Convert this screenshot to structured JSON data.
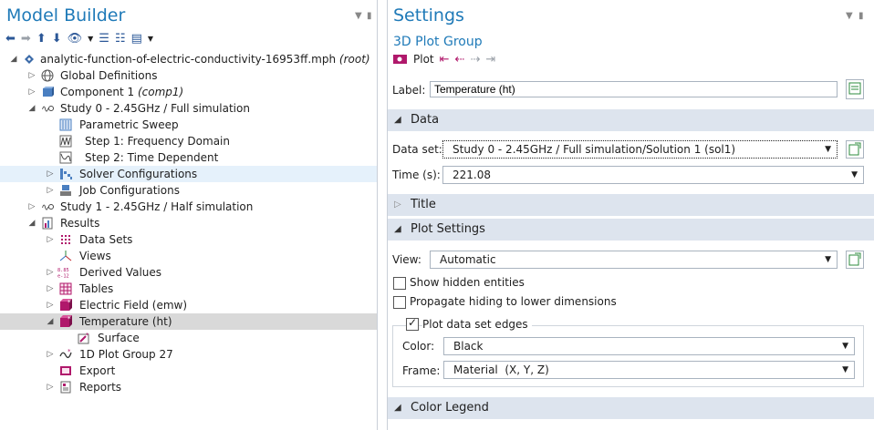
{
  "model_builder": {
    "title": "Model Builder",
    "tree": [
      {
        "label": "analytic-function-of-electric-conductivity-16953ff.mph",
        "tag": "(root)",
        "icon": "model-icon"
      },
      {
        "label": "Global Definitions",
        "icon": "globe-icon"
      },
      {
        "label": "Component 1",
        "tag": "(comp1)",
        "icon": "component-icon"
      },
      {
        "label": "Study 0 - 2.45GHz / Full simulation",
        "icon": "study-icon"
      },
      {
        "label": "Parametric Sweep",
        "icon": "sweep-icon"
      },
      {
        "label": "Step 1: Frequency Domain",
        "icon": "frequency-step-icon"
      },
      {
        "label": "Step 2: Time Dependent",
        "icon": "time-step-icon"
      },
      {
        "label": "Solver Configurations",
        "icon": "solver-icon"
      },
      {
        "label": "Job Configurations",
        "icon": "job-icon"
      },
      {
        "label": "Study 1 - 2.45GHz / Half simulation",
        "icon": "study-icon"
      },
      {
        "label": "Results",
        "icon": "results-icon"
      },
      {
        "label": "Data Sets",
        "icon": "datasets-icon"
      },
      {
        "label": "Views",
        "icon": "views-icon"
      },
      {
        "label": "Derived Values",
        "icon": "derived-values-icon",
        "glyph": "8.85\ne-12"
      },
      {
        "label": "Tables",
        "icon": "table-icon"
      },
      {
        "label": "Electric Field (emw)",
        "icon": "plot3d-icon"
      },
      {
        "label": "Temperature (ht)",
        "icon": "plot3d-icon"
      },
      {
        "label": "Surface",
        "icon": "surface-icon"
      },
      {
        "label": "1D Plot Group 27",
        "icon": "plot1d-icon"
      },
      {
        "label": "Export",
        "icon": "export-icon"
      },
      {
        "label": "Reports",
        "icon": "reports-icon"
      }
    ]
  },
  "settings": {
    "title": "Settings",
    "subtitle": "3D Plot Group",
    "plot_label": "Plot",
    "label_field": {
      "label": "Label:",
      "value": "Temperature (ht)"
    },
    "sections": {
      "data": "Data",
      "title": "Title",
      "plot_settings": "Plot Settings",
      "color_legend": "Color Legend"
    },
    "data_set": {
      "label": "Data set:",
      "value": "Study 0 - 2.45GHz / Full simulation/Solution 1 (sol1)"
    },
    "time": {
      "label": "Time (s):",
      "value": "221.08"
    },
    "view": {
      "label": "View:",
      "value": "Automatic"
    },
    "show_hidden": {
      "label": "Show hidden entities",
      "checked": false
    },
    "propagate_hiding": {
      "label": "Propagate hiding to lower dimensions",
      "checked": false
    },
    "plot_edges": {
      "label": "Plot data set edges",
      "checked": true
    },
    "color": {
      "label": "Color:",
      "value": "Black"
    },
    "frame": {
      "label": "Frame:",
      "value": "Material  (X, Y, Z)"
    }
  },
  "colors": {
    "title_blue": "#1f7ab8",
    "section_bg": "#dde4ee",
    "plot_accent": "#b0186b"
  }
}
